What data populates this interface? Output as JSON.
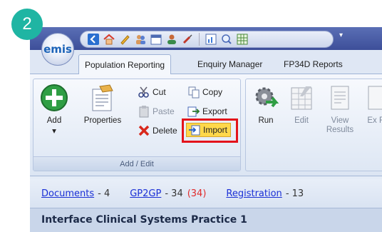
{
  "step_number": "2",
  "app": {
    "logo_text": "emis"
  },
  "quick_access": {
    "icons": [
      "back-icon",
      "home-icon",
      "pencil-icon",
      "users-icon",
      "calendar-icon",
      "patient-icon",
      "syringe-icon",
      "chart-icon",
      "search-icon",
      "grid-icon"
    ]
  },
  "tabs": [
    {
      "label": "Population Reporting",
      "active": true
    },
    {
      "label": "Enquiry Manager",
      "active": false
    },
    {
      "label": "FP34D Reports",
      "active": false
    }
  ],
  "ribbon": {
    "add_edit_group": {
      "label": "Add / Edit",
      "add_label": "Add",
      "properties_label": "Properties",
      "cut_label": "Cut",
      "copy_label": "Copy",
      "paste_label": "Paste",
      "export_label": "Export",
      "delete_label": "Delete",
      "import_label": "Import"
    },
    "run_group": {
      "run_label": "Run",
      "edit_label": "Edit",
      "view_results_label": "View Results",
      "export_results_label": "Ex Re"
    }
  },
  "status": {
    "documents_label": "Documents",
    "documents_count": "- 4",
    "gp2gp_label": "GP2GP",
    "gp2gp_count": "- 34",
    "gp2gp_pending": "(34)",
    "registration_label": "Registration",
    "registration_count": "- 13"
  },
  "practice_name": "Interface Clinical Systems Practice 1",
  "colors": {
    "highlight": "#e3131b",
    "badge": "#1fb5a3",
    "link": "#1a2fd6",
    "pending": "#e02a2a"
  }
}
